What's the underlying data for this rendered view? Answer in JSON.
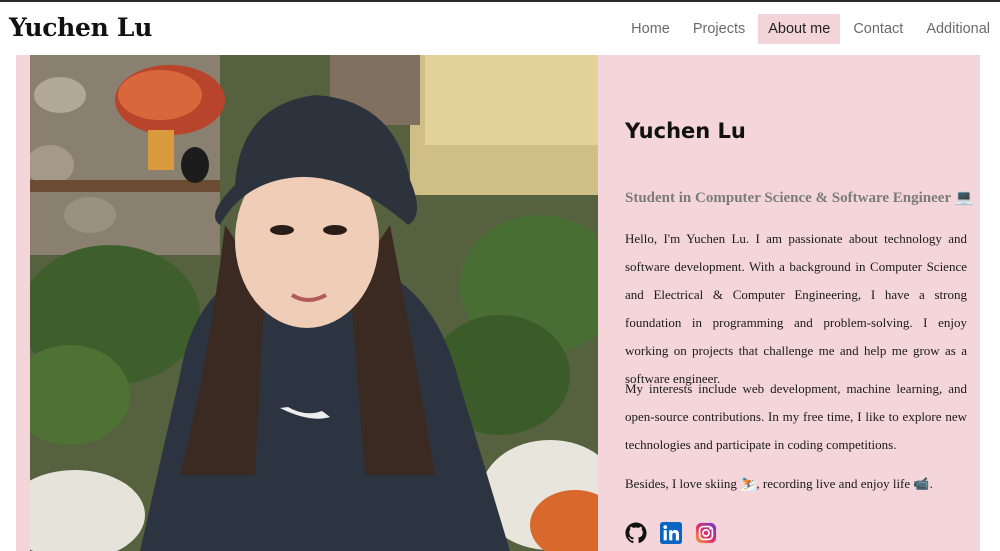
{
  "header": {
    "brand": "Yuchen Lu",
    "nav": [
      "Home",
      "Projects",
      "About me",
      "Contact",
      "Additional"
    ],
    "active": "About me"
  },
  "profile": {
    "name": "Yuchen Lu",
    "subtitle": "Student in Computer Science & Software Engineer 💻",
    "paragraphs": [
      "Hello, I'm Yuchen Lu. I am passionate about technology and software development. With a background in Computer Science and Electrical & Computer Engineering, I have a strong foundation in programming and problem-solving. I enjoy working on projects that challenge me and help me grow as a software engineer.",
      "My interests include web development, machine learning, and open-source contributions. In my free time, I like to explore new technologies and participate in coding competitions.",
      "Besides, I love skiing ⛷️, recording live and enjoy life 📹."
    ],
    "socials": [
      "github-icon",
      "linkedin-icon",
      "instagram-icon"
    ]
  },
  "colors": {
    "accent": "#f4d6da",
    "active_tab": "#f2d4d9",
    "linkedin": "#0a66c2"
  }
}
